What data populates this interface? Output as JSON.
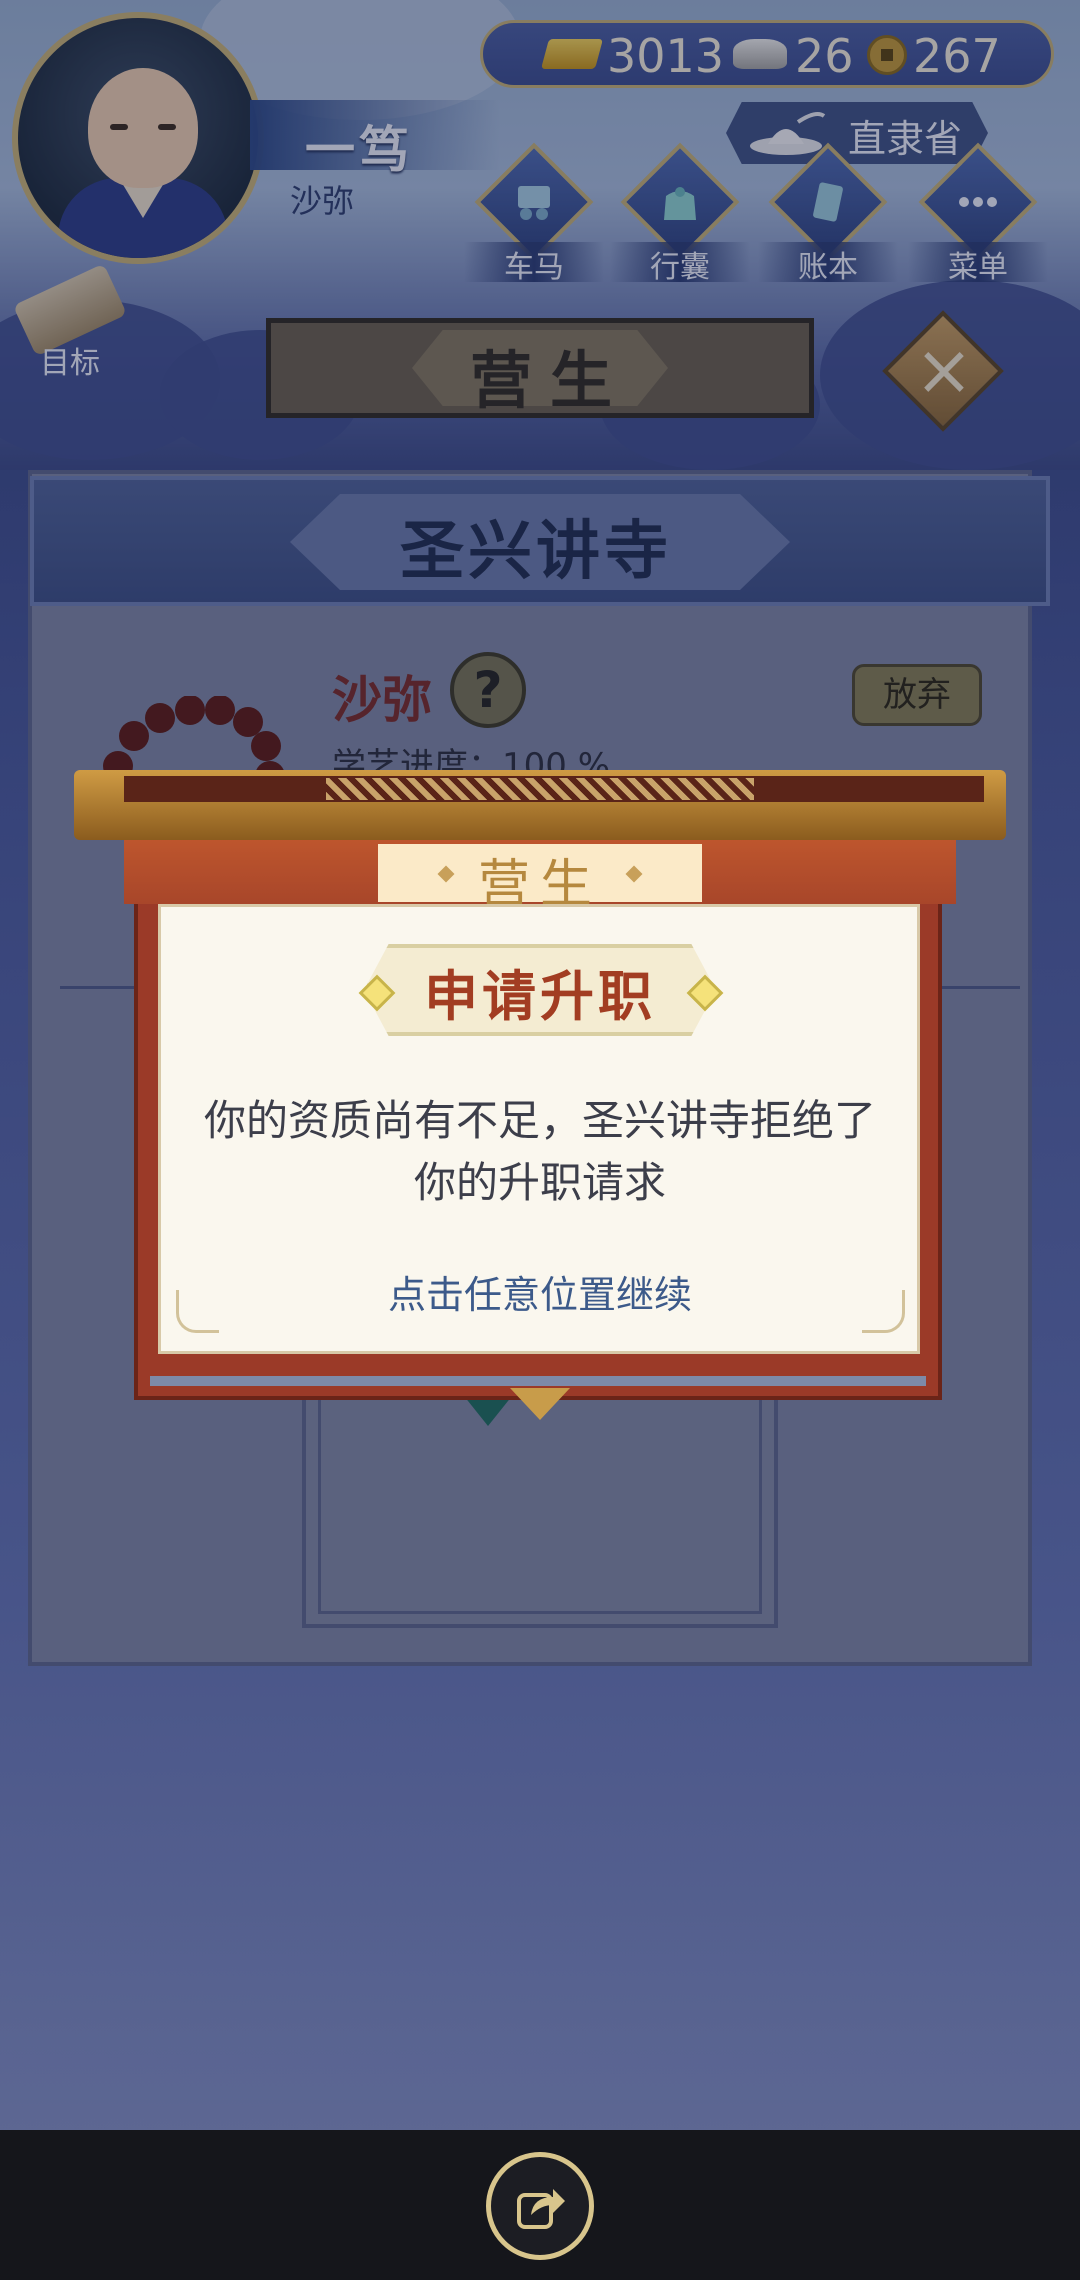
{
  "player": {
    "name": "一笃",
    "rank": "沙弥"
  },
  "currency": {
    "gold": "3013",
    "silver": "26",
    "copper": "267"
  },
  "location": {
    "province": "直隶省"
  },
  "nav": [
    {
      "label": "车马",
      "icon": "carriage-icon"
    },
    {
      "label": "行囊",
      "icon": "bag-icon"
    },
    {
      "label": "账本",
      "icon": "ledger-icon"
    },
    {
      "label": "菜单",
      "icon": "menu-icon"
    }
  ],
  "goal": {
    "label": "目标"
  },
  "page": {
    "title": "营生"
  },
  "career": {
    "temple": "圣兴讲寺",
    "rank": "沙弥",
    "help": "?",
    "give_up": "放弃",
    "progress": "学艺进度：100 %"
  },
  "modal": {
    "tab": "营生",
    "title": "申请升职",
    "message": "你的资质尚有不足，圣兴讲寺拒绝了你的升职请求",
    "hint": "点击任意位置继续"
  },
  "colors": {
    "accent_gold": "#c6b27a",
    "modal_red": "#9b3a28",
    "title_red": "#a23d22"
  }
}
